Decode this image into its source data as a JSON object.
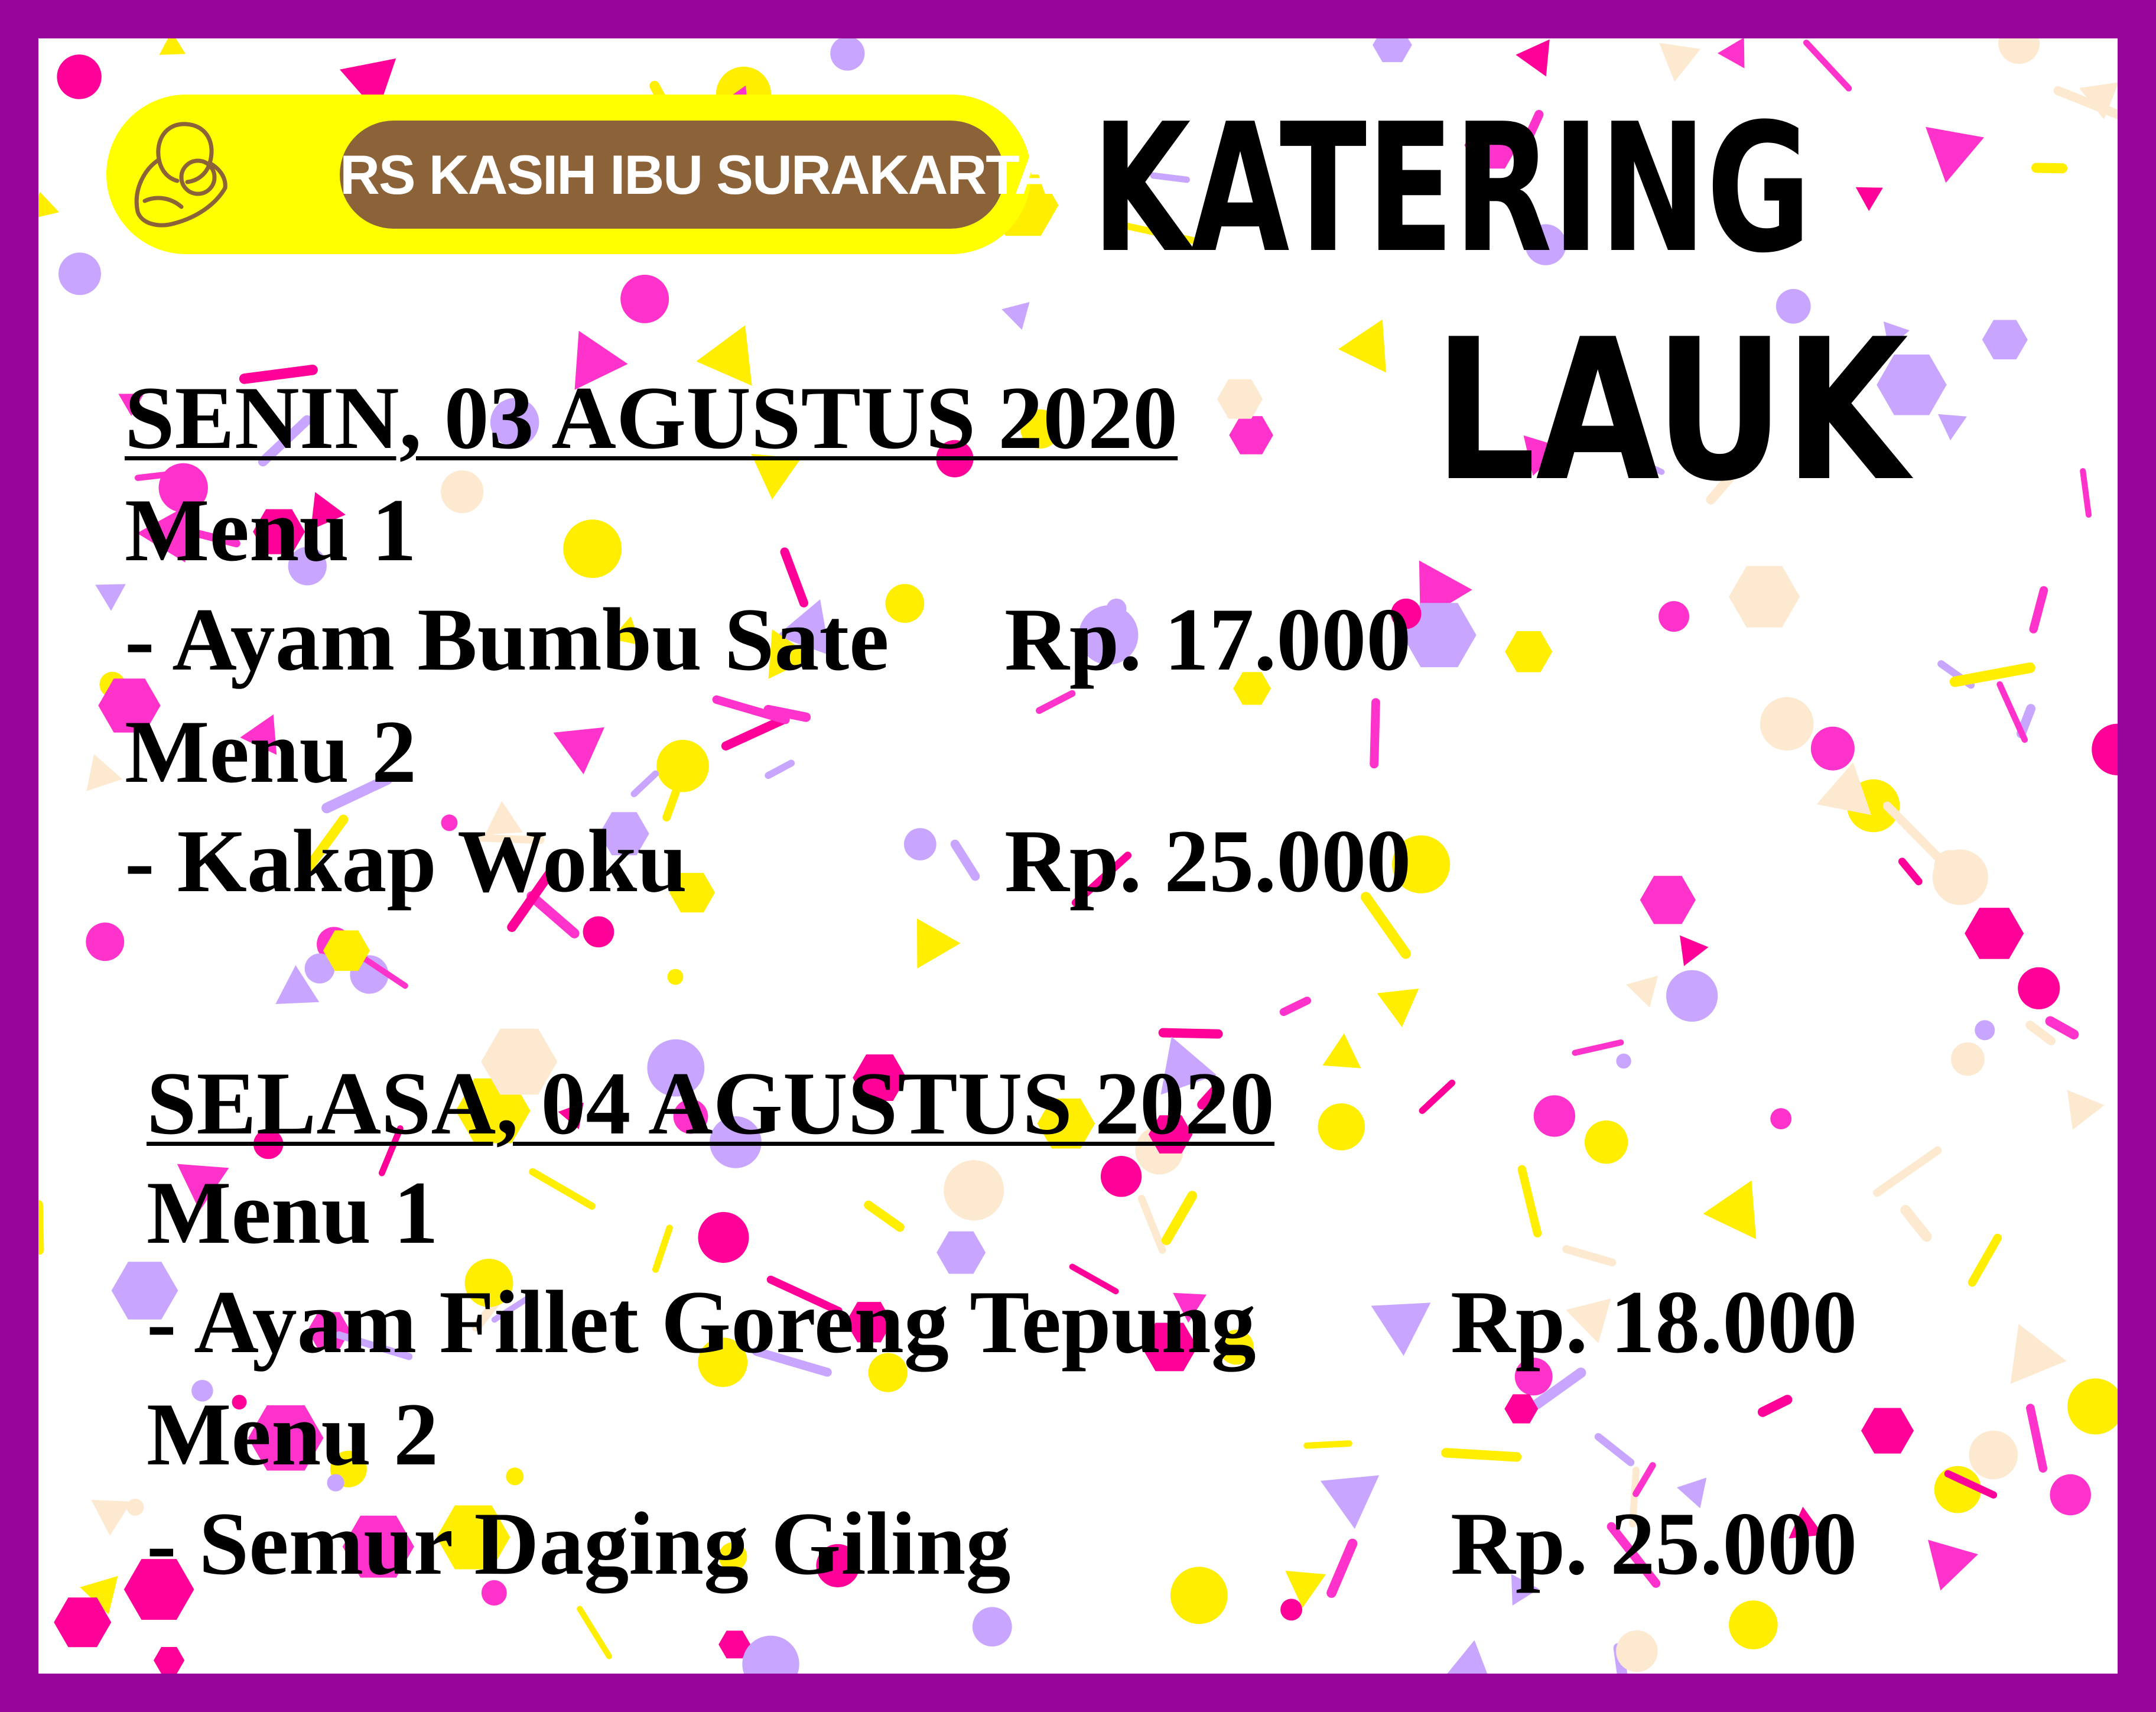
{
  "colors": {
    "border": "#98059b",
    "logo_pill": "#ffff00",
    "logo_label_bg": "#8c6239",
    "confetti": [
      "#ff33cc",
      "#ffee00",
      "#c8a6ff",
      "#fde9cf",
      "#ff0099"
    ]
  },
  "logo": {
    "icon": "mother-child-icon",
    "name": "RS KASIH IBU SURAKARTA"
  },
  "title": {
    "line1": "KATERING",
    "line2": "LAUK"
  },
  "days": [
    {
      "heading": "SENIN, 03 AGUSTUS 2020",
      "menus": [
        {
          "label": "Menu 1",
          "item": "- Ayam Bumbu Sate",
          "price": "Rp. 17.000"
        },
        {
          "label": "Menu 2",
          "item": "- Kakap Woku",
          "price": "Rp. 25.000"
        }
      ]
    },
    {
      "heading": "SELASA, 04 AGUSTUS 2020",
      "menus": [
        {
          "label": "Menu 1",
          "item": "- Ayam Fillet Goreng Tepung",
          "price": "Rp. 18.000"
        },
        {
          "label": "Menu 2",
          "item": "- Semur Daging Giling",
          "price": "Rp. 25.000"
        }
      ]
    }
  ]
}
